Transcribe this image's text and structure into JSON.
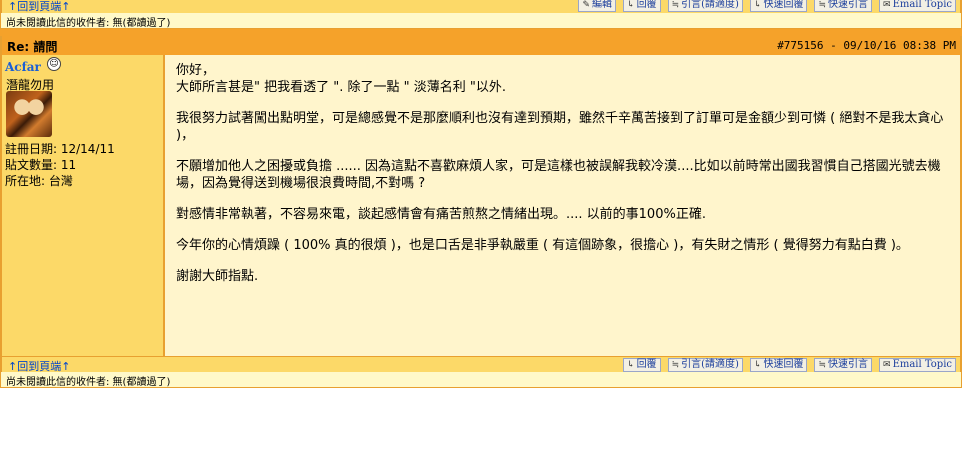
{
  "top": {
    "back_link": "↑回到頁端↑",
    "buttons": [
      {
        "icon": "edit-icon",
        "glyph": "✎",
        "label": "編輯"
      },
      {
        "icon": "reply-icon",
        "glyph": "↳",
        "label": "回覆"
      },
      {
        "icon": "quote-icon",
        "glyph": "≒",
        "label": "引言(請適度)"
      },
      {
        "icon": "quick-reply-icon",
        "glyph": "↳",
        "label": "快速回覆"
      },
      {
        "icon": "quick-quote-icon",
        "glyph": "≒",
        "label": "快速引言"
      },
      {
        "icon": "email-icon",
        "glyph": "✉",
        "label": "Email Topic"
      }
    ],
    "unread": "尚未閱讀此信的收件者: 無(都讀過了)"
  },
  "post": {
    "subject": "Re: 請問",
    "meta": "#775156 - 09/10/16 08:38 PM",
    "author": {
      "name": "Acfar",
      "rank": "潛龍勿用",
      "registered": "註冊日期: 12/14/11",
      "posts": "貼文數量: 11",
      "location": "所在地: 台灣"
    },
    "greeting": "你好，",
    "para1": "大師所言甚是\" 把我看透了 \". 除了一點 \" 淡薄名利 \"以外.",
    "para2": "我很努力試著闖出點明堂，可是總感覺不是那麼順利也沒有達到預期，雖然千辛萬苦接到了訂單可是金額少到可憐 ( 絕對不是我太貪心 )，",
    "para3": "不願增加他人之困擾或負擔 ...... 因為這點不喜歡麻煩人家，可是這樣也被誤解我較冷漠....比如以前時常出國我習慣自己搭國光號去機場，因為覺得送到機場很浪費時間,不對嗎 ?",
    "para4": "對感情非常執著，不容易來電，談起感情會有痛苦煎熬之情緒出現。.... 以前的事100%正確.",
    "para5": "今年你的心情煩躁 ( 100% 真的很煩 )，也是口舌是非爭執嚴重 ( 有這個跡象，很擔心 )，有失財之情形 ( 覺得努力有點白費 )。",
    "para6": "謝謝大師指點."
  },
  "bottom": {
    "back_link": "↑回到頁端↑",
    "buttons": [
      {
        "icon": "reply-icon",
        "glyph": "↳",
        "label": "回覆"
      },
      {
        "icon": "quote-icon",
        "glyph": "≒",
        "label": "引言(請適度)"
      },
      {
        "icon": "quick-reply-icon",
        "glyph": "↳",
        "label": "快速回覆"
      },
      {
        "icon": "quick-quote-icon",
        "glyph": "≒",
        "label": "快速引言"
      },
      {
        "icon": "email-icon",
        "glyph": "✉",
        "label": "Email Topic"
      }
    ],
    "unread": "尚未閱讀此信的收件者: 無(都讀過了)"
  }
}
